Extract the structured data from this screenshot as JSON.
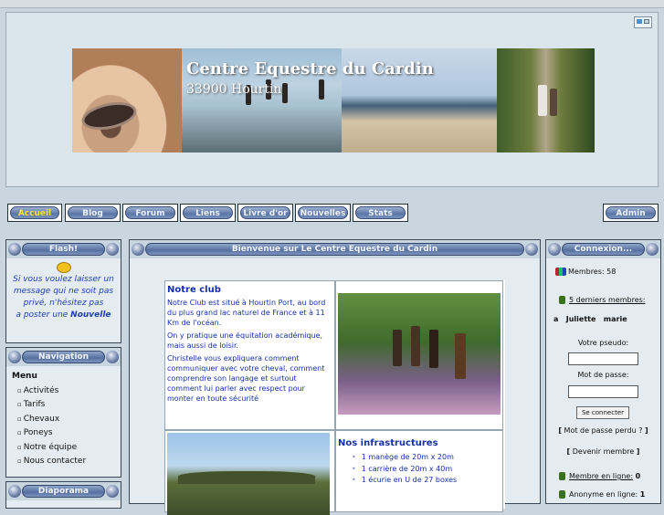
{
  "header": {
    "banner_title": "Centre Equestre du Cardin",
    "banner_subtitle": "33900 Hourtin"
  },
  "nav": [
    {
      "label": "Accueil",
      "active": true
    },
    {
      "label": "Blog"
    },
    {
      "label": "Forum"
    },
    {
      "label": "Liens"
    },
    {
      "label": "Livre d'or"
    },
    {
      "label": "Nouvelles"
    },
    {
      "label": "Stats"
    },
    {
      "label": "Admin"
    }
  ],
  "flash": {
    "title": "Flash!",
    "line1": "Si vous voulez laisser un",
    "line2": "message qui ne soit pas",
    "line3": "privé, n'hésitez pas",
    "line4_prefix": "a poster une ",
    "line4_bold": "Nouvelle"
  },
  "navigation": {
    "title": "Navigation",
    "menu": "Menu",
    "items": [
      "Activités",
      "Tarifs",
      "Chevaux",
      "Poneys",
      "Notre équipe",
      "Nous contacter"
    ]
  },
  "diaporama": {
    "title": "Diaporama"
  },
  "main": {
    "title": "Bienvenue sur Le Centre Equestre du Cardin",
    "club_title": "Notre club",
    "club_p1": "Notre Club est situé à Hourtin Port, au bord du plus grand lac naturel de France et à 11 Km de l'océan.",
    "club_p2": "On y pratique une équitation académique, mais aussi de loisir.",
    "club_p3": "Christelle vous expliquera comment communiquer avec votre cheval, comment comprendre son langage et surtout comment lui parler avec respect pour monter en toute sécurité",
    "infra_title": "Nos infrastructures",
    "infra_items": [
      "1 manège de 20m x 20m",
      "1 carrière de 20m x 40m",
      "1 écurie en U de 27 boxes"
    ]
  },
  "connexion": {
    "title": "Connexion...",
    "members": "Membres: 58",
    "last_members": "5 derniers membres:",
    "last_list": "a   Juliette   marie",
    "pseudo_label": "Votre pseudo:",
    "pass_label": "Mot de passe:",
    "connect_btn": "Se connecter",
    "lost_pass": "Mot de passe perdu ?",
    "become_member": "Devenir membre",
    "online_label": "Membre en ligne:",
    "online_value": "0",
    "anon_label": "Anonyme en ligne:",
    "anon_value": "1"
  }
}
